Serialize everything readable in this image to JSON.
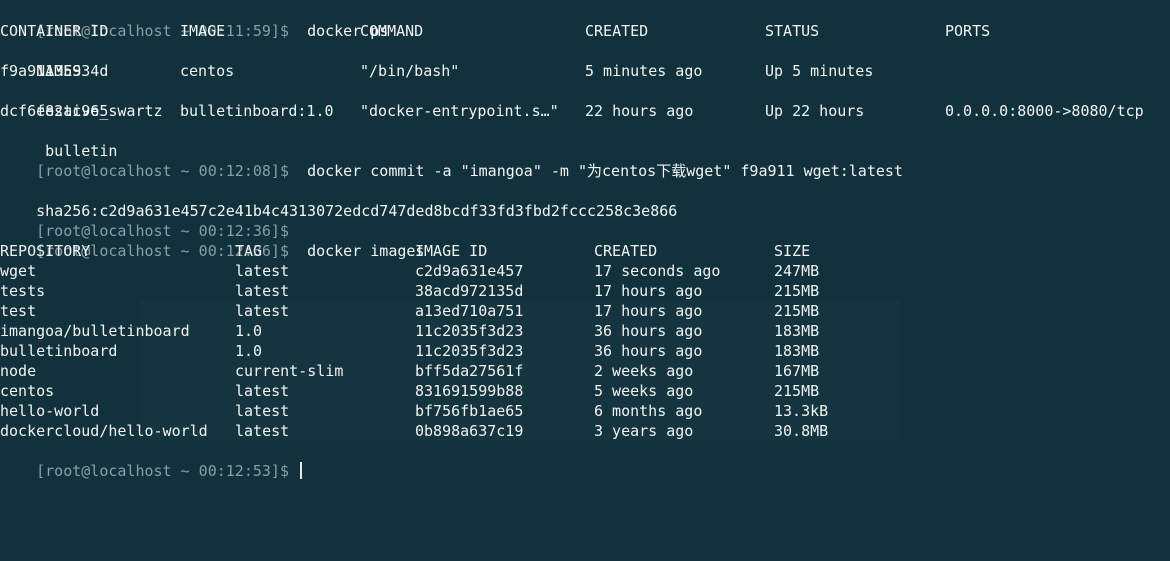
{
  "prompt": {
    "p1": "[root@localhost ~ 00:11:59]$",
    "p2": "[root@localhost ~ 00:12:08]$",
    "p3": "[root@localhost ~ 00:12:36]$",
    "p4": "[root@localhost ~ 00:12:36]$",
    "p5": "[root@localhost ~ 00:12:53]$"
  },
  "commands": {
    "ps": "docker ps",
    "commit": "docker commit -a \"imangoa\" -m \"为centos下载wget\" f9a911 wget:latest",
    "images": "docker images"
  },
  "ps": {
    "headers": [
      "CONTAINER ID",
      "IMAGE",
      "COMMAND",
      "CREATED",
      "STATUS",
      "PORTS"
    ],
    "names_header": "NAMES",
    "rows": [
      {
        "id": "f9a91135934d",
        "image": "centos",
        "command": "\"/bin/bash\"",
        "created": "5 minutes ago",
        "status": "Up 5 minutes",
        "ports": "",
        "name": "festive_swartz"
      },
      {
        "id": "dcf6e82ac965",
        "image": "bulletinboard:1.0",
        "command": "\"docker-entrypoint.s…\"",
        "created": "22 hours ago",
        "status": "Up 22 hours",
        "ports": "0.0.0.0:8000->8080/tcp",
        "name": " bulletin"
      }
    ]
  },
  "commit_output": "sha256:c2d9a631e457c2e41b4c4313072edcd747ded8bcdf33fd3fbd2fccc258c3e866",
  "images": {
    "headers": [
      "REPOSITORY",
      "TAG",
      "IMAGE ID",
      "CREATED",
      "SIZE"
    ],
    "rows": [
      {
        "repo": "wget",
        "tag": "latest",
        "id": "c2d9a631e457",
        "created": "17 seconds ago",
        "size": "247MB"
      },
      {
        "repo": "tests",
        "tag": "latest",
        "id": "38acd972135d",
        "created": "17 hours ago",
        "size": "215MB"
      },
      {
        "repo": "test",
        "tag": "latest",
        "id": "a13ed710a751",
        "created": "17 hours ago",
        "size": "215MB"
      },
      {
        "repo": "imangoa/bulletinboard",
        "tag": "1.0",
        "id": "11c2035f3d23",
        "created": "36 hours ago",
        "size": "183MB"
      },
      {
        "repo": "bulletinboard",
        "tag": "1.0",
        "id": "11c2035f3d23",
        "created": "36 hours ago",
        "size": "183MB"
      },
      {
        "repo": "node",
        "tag": "current-slim",
        "id": "bff5da27561f",
        "created": "2 weeks ago",
        "size": "167MB"
      },
      {
        "repo": "centos",
        "tag": "latest",
        "id": "831691599b88",
        "created": "5 weeks ago",
        "size": "215MB"
      },
      {
        "repo": "hello-world",
        "tag": "latest",
        "id": "bf756fb1ae65",
        "created": "6 months ago",
        "size": "13.3kB"
      },
      {
        "repo": "dockercloud/hello-world",
        "tag": "latest",
        "id": "0b898a637c19",
        "created": "3 years ago",
        "size": "30.8MB"
      }
    ]
  },
  "colors": {
    "background": "#11323c",
    "text": "#f4f4f4",
    "prompt": "#8a9ea4"
  }
}
